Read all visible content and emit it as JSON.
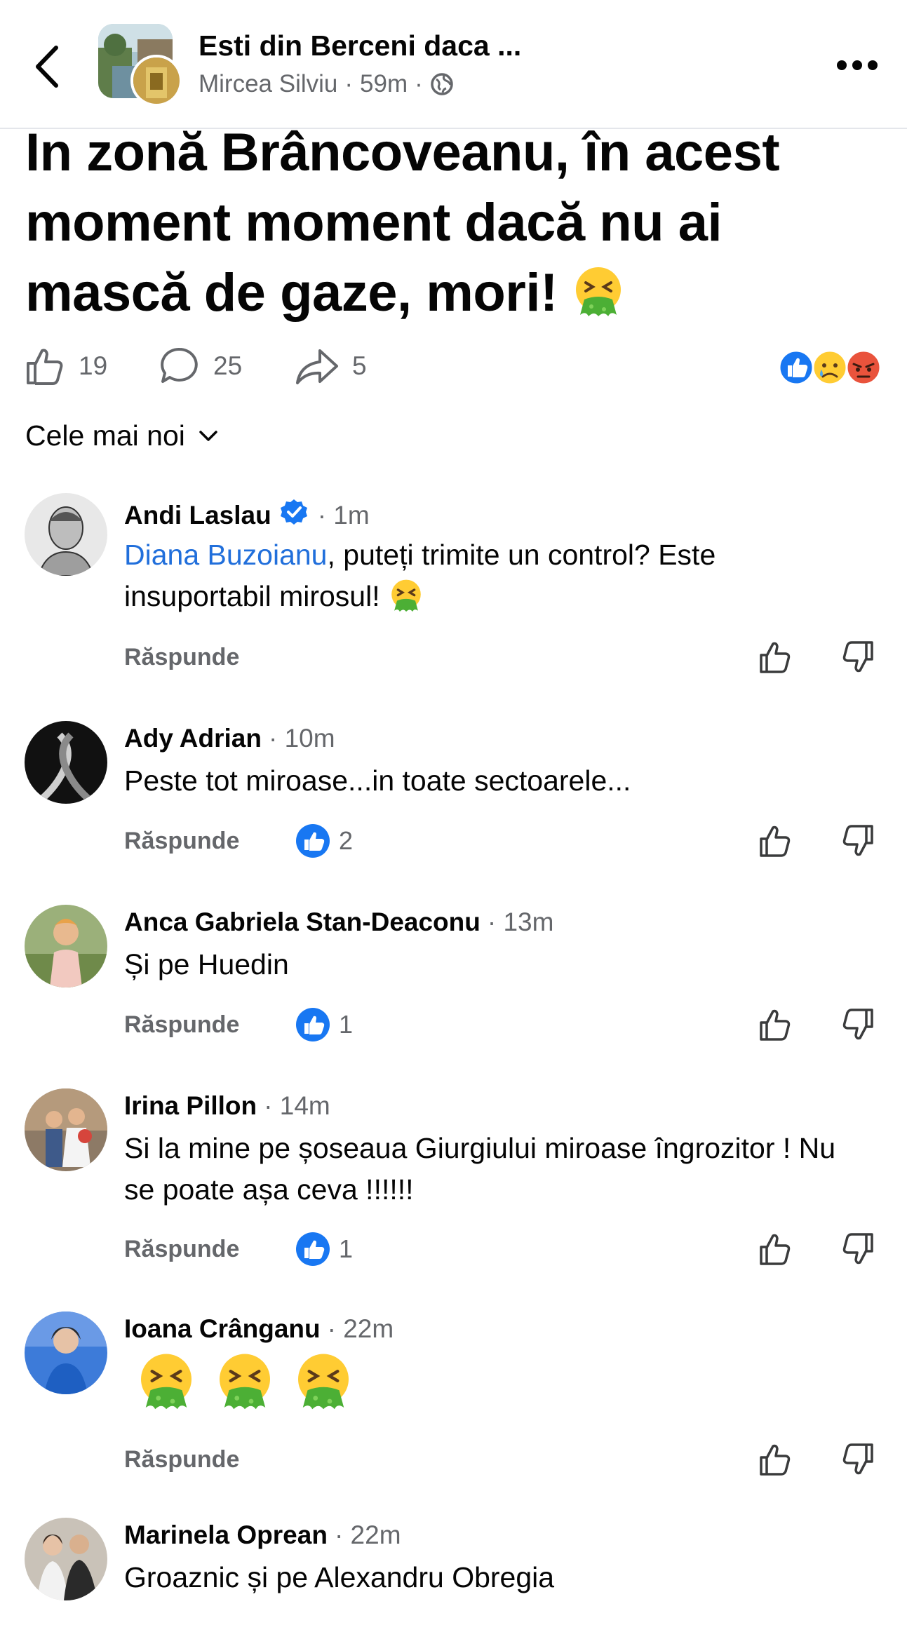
{
  "header": {
    "group_title": "Esti din Berceni daca ...",
    "author": "Mircea Silviu",
    "separator": "·",
    "time": "59m",
    "audience_icon": "globe-icon",
    "more_icon": "more-dots-icon",
    "back_icon": "chevron-left-icon"
  },
  "post": {
    "text": "In zonă Brâncoveanu, în acest moment moment dacă nu ai mască de gaze, mori!",
    "emoji": "nauseated-vomiting-face",
    "like_count": "19",
    "comment_count": "25",
    "share_count": "5",
    "reactions": [
      "like",
      "sad",
      "angry"
    ]
  },
  "sort": {
    "label": "Cele mai noi"
  },
  "comments": [
    {
      "name": "Andi Laslau",
      "verified": true,
      "time": "· 1m",
      "mention": "Diana Buzoianu",
      "text": ", puteți trimite un control? Este insuportabil mirosul!",
      "reply": "Răspunde",
      "likes": ""
    },
    {
      "name": "Ady Adrian",
      "time": "· 10m",
      "text": "Peste tot miroase...in toate sectoarele...",
      "reply": "Răspunde",
      "likes": "2"
    },
    {
      "name": "Anca Gabriela Stan-Deaconu",
      "time": "· 13m",
      "text": "Și pe Huedin",
      "reply": "Răspunde",
      "likes": "1"
    },
    {
      "name": "Irina Pillon",
      "time": "· 14m",
      "text": "Si la mine pe șoseaua Giurgiului miroase îngrozitor ! Nu se poate așa ceva !!!!!!",
      "reply": "Răspunde",
      "likes": "1"
    },
    {
      "name": "Ioana Crânganu",
      "time": "· 22m",
      "emojis": [
        "nauseated-vomiting-face",
        "nauseated-vomiting-face",
        "nauseated-vomiting-face"
      ],
      "reply": "Răspunde",
      "likes": ""
    },
    {
      "name": "Marinela Oprean",
      "time": "· 22m",
      "text": "Groaznic și pe Alexandru Obregia"
    }
  ],
  "colors": {
    "link": "#216fdb",
    "secondary_text": "#65676b",
    "like_blue": "#1877f2",
    "vomit_green": "#4caf35",
    "emoji_yellow": "#ffcc33"
  }
}
